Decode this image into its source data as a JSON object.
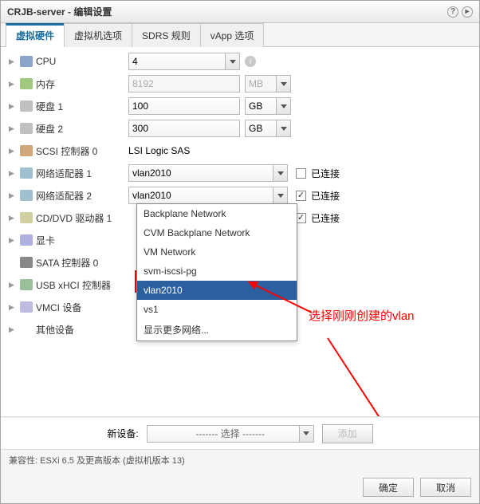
{
  "title": "CRJB-server - 编辑设置",
  "tabs": {
    "t0": "虚拟硬件",
    "t1": "虚拟机选项",
    "t2": "SDRS 规则",
    "t3": "vApp 选项"
  },
  "rows": {
    "cpu": {
      "label": "CPU",
      "value": "4"
    },
    "mem": {
      "label": "内存",
      "value": "8192",
      "unit": "MB"
    },
    "hdd1": {
      "label": "硬盘 1",
      "value": "100",
      "unit": "GB"
    },
    "hdd2": {
      "label": "硬盘 2",
      "value": "300",
      "unit": "GB"
    },
    "scsi": {
      "label": "SCSI 控制器 0",
      "value": "LSI Logic SAS"
    },
    "nic1": {
      "label": "网络适配器 1",
      "value": "vlan2010",
      "connected": false,
      "conn_label": "已连接"
    },
    "nic2": {
      "label": "网络适配器 2",
      "value": "vlan2010",
      "connected": true,
      "conn_label": "已连接"
    },
    "cd": {
      "label": "CD/DVD 驱动器 1",
      "connected": true,
      "conn_label": "已连接"
    },
    "gpu": {
      "label": "显卡"
    },
    "sata": {
      "label": "SATA 控制器 0"
    },
    "usb": {
      "label": "USB xHCI 控制器"
    },
    "vmci": {
      "label": "VMCI 设备"
    },
    "other": {
      "label": "其他设备"
    }
  },
  "dropdown": {
    "opt0": "Backplane Network",
    "opt1": "CVM Backplane Network",
    "opt2": "VM Network",
    "opt3": "svm-iscsi-pg",
    "opt4": "vlan2010",
    "opt5": "vs1",
    "opt6": "显示更多网络..."
  },
  "annotation": "选择刚刚创建的vlan",
  "new_device": {
    "label": "新设备:",
    "placeholder": "------- 选择 -------",
    "add": "添加"
  },
  "compat": "兼容性: ESXi 6.5 及更高版本 (虚拟机版本 13)",
  "buttons": {
    "ok": "确定",
    "cancel": "取消"
  }
}
